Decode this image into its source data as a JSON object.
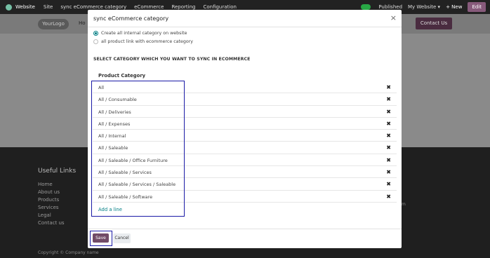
{
  "topbar": {
    "app_name": "Website",
    "menu": [
      "Site",
      "sync eCommerce category",
      "eCommerce",
      "Reporting",
      "Configuration"
    ],
    "published": "Published",
    "my_website": "My Website ▾",
    "new": "+ New",
    "edit": "Edit"
  },
  "site": {
    "logo_text": "YourLogo",
    "home": "Ho",
    "contact": "Contact Us"
  },
  "footer": {
    "useful_links": "Useful Links",
    "links": [
      "Home",
      "About us",
      "Products",
      "Services",
      "Legal",
      "Contact us"
    ],
    "copyright": "Copyright © Company name",
    "edge_text": "m"
  },
  "modal": {
    "title": "sync eCommerce category",
    "close": "×",
    "options": [
      {
        "label": "Create all internal category on website",
        "checked": true
      },
      {
        "label": "all product link with ecommerce category",
        "checked": false
      }
    ],
    "section_label": "SELECT CATEGORY WHICH YOU WANT TO SYNC IN ECOMMERCE",
    "column_header": "Product Category",
    "rows": [
      "All",
      "All / Consumable",
      "All / Deliveries",
      "All / Expenses",
      "All / Internal",
      "All / Saleable",
      "All / Saleable / Office Furniture",
      "All / Saleable / Services",
      "All / Saleable / Services / Saleable",
      "All / Saleable / Software"
    ],
    "delete_glyph": "✖",
    "add_line": "Add a line",
    "save": "Save",
    "cancel": "Cancel"
  }
}
